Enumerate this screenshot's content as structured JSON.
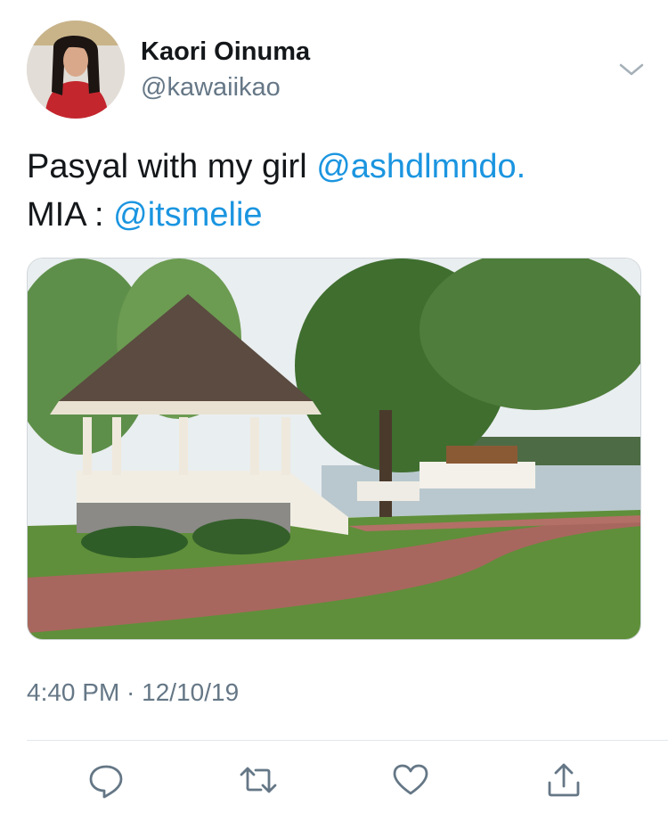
{
  "author": {
    "display_name": "Kaori Oinuma",
    "handle": "@kawaiikao"
  },
  "tweet": {
    "line1_text": "Pasyal with my girl ",
    "line1_mention": "@ashdlmndo.",
    "line2_text": "MIA : ",
    "line2_mention": "@itsmelie",
    "timestamp": "4:40 PM · 12/10/19"
  },
  "colors": {
    "mention": "#1b95e0",
    "secondary_text": "#657786",
    "icon": "#657786",
    "divider": "#e1e8ed"
  },
  "icons": {
    "menu": "chevron-down-icon",
    "reply": "reply-icon",
    "retweet": "retweet-icon",
    "like": "heart-icon",
    "share": "share-icon"
  }
}
